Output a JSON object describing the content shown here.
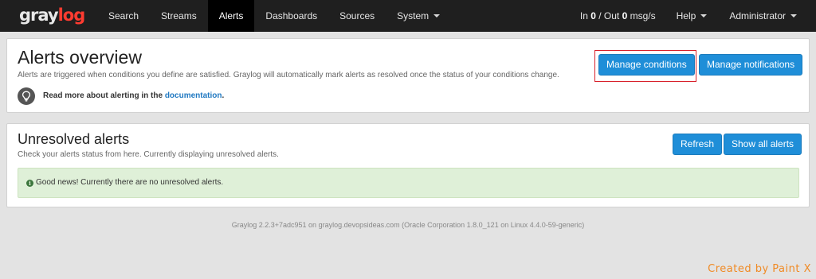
{
  "navbar": {
    "brand_main": "gray",
    "brand_accent": "log",
    "items": [
      {
        "label": "Search"
      },
      {
        "label": "Streams"
      },
      {
        "label": "Alerts"
      },
      {
        "label": "Dashboards"
      },
      {
        "label": "Sources"
      },
      {
        "label": "System"
      }
    ],
    "throughput_in_prefix": "In ",
    "throughput_in_value": "0",
    "throughput_mid": " / Out ",
    "throughput_out_value": "0",
    "throughput_suffix": " msg/s",
    "help_label": "Help",
    "user_label": "Administrator",
    "active_item": "Alerts"
  },
  "overview": {
    "title": "Alerts overview",
    "description": "Alerts are triggered when conditions you define are satisfied. Graylog will automatically mark alerts as resolved once the status of your conditions change.",
    "doc_prefix": "Read more about alerting in the ",
    "doc_link": "documentation",
    "doc_suffix": ".",
    "manage_conditions_label": "Manage conditions",
    "manage_notifications_label": "Manage notifications"
  },
  "unresolved": {
    "title": "Unresolved alerts",
    "description": "Check your alerts status from here. Currently displaying unresolved alerts.",
    "refresh_label": "Refresh",
    "show_all_label": "Show all alerts",
    "info_glyph": "i",
    "success_message": "Good news! Currently there are no unresolved alerts."
  },
  "footer": {
    "text": "Graylog 2.2.3+7adc951 on graylog.devopsideas.com (Oracle Corporation 1.8.0_121 on Linux 4.4.0-59-generic)"
  },
  "watermark": "Created by Paint X",
  "colors": {
    "navbar_bg": "#1f1f1f",
    "brand_accent": "#ff3b30",
    "primary_button": "#1f8ed8",
    "highlight_box": "#d8202a",
    "success_bg": "#dff0d8",
    "link": "#1f78c1",
    "watermark": "#f08a24"
  },
  "icons": {
    "doc_icon": "lightbulb-icon",
    "info_icon": "info-circle-icon",
    "dropdown_icon": "caret-down-icon"
  }
}
